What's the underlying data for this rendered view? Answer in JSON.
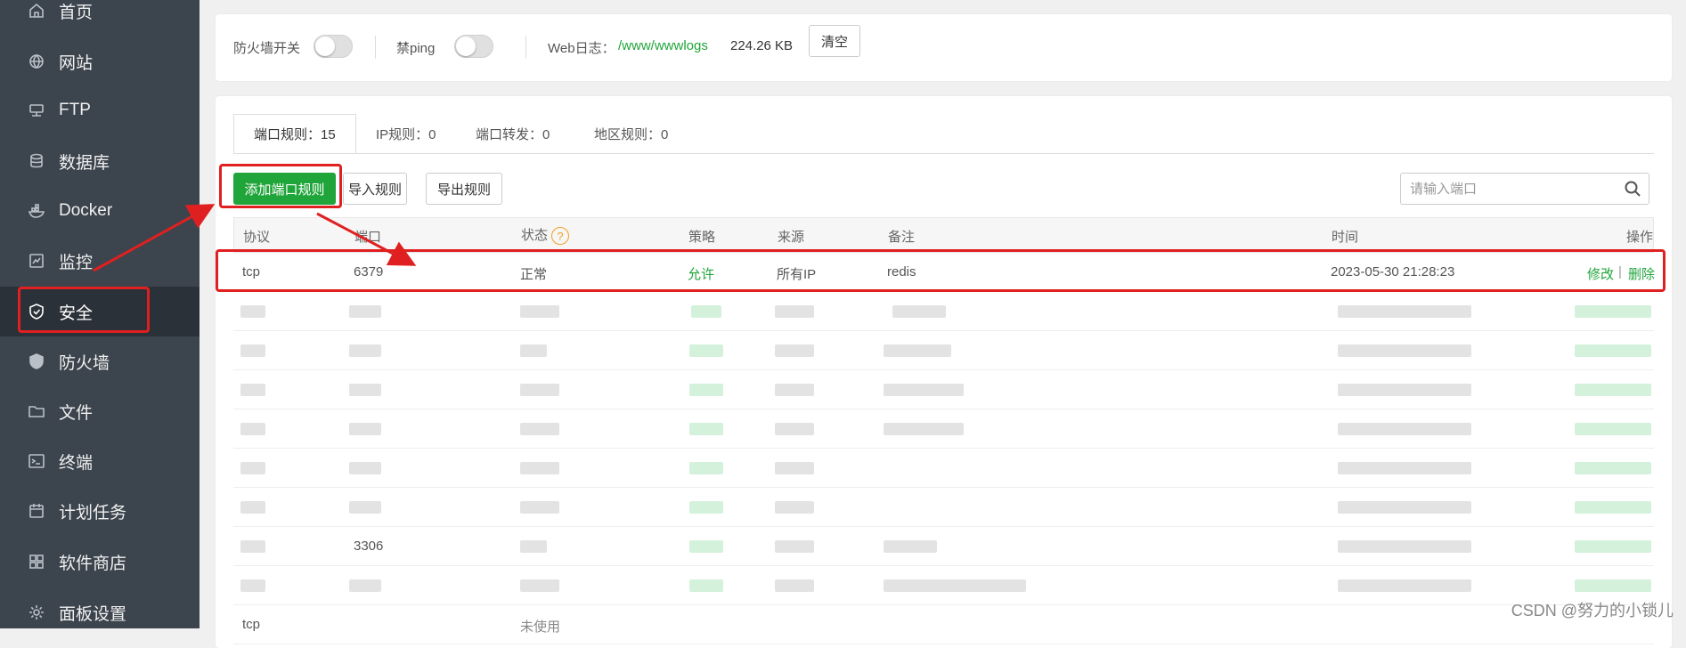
{
  "sidebar": {
    "items": [
      {
        "label": "首页",
        "icon": "home-icon"
      },
      {
        "label": "网站",
        "icon": "globe-icon"
      },
      {
        "label": "FTP",
        "icon": "ftp-icon"
      },
      {
        "label": "数据库",
        "icon": "database-icon"
      },
      {
        "label": "Docker",
        "icon": "docker-icon"
      },
      {
        "label": "监控",
        "icon": "monitor-icon"
      },
      {
        "label": "安全",
        "icon": "shield-check-icon"
      },
      {
        "label": "防火墙",
        "icon": "shield-icon"
      },
      {
        "label": "文件",
        "icon": "folder-icon"
      },
      {
        "label": "终端",
        "icon": "terminal-icon"
      },
      {
        "label": "计划任务",
        "icon": "calendar-icon"
      },
      {
        "label": "软件商店",
        "icon": "grid-icon"
      },
      {
        "label": "面板设置",
        "icon": "gear-icon"
      }
    ],
    "active": "安全"
  },
  "top_bar": {
    "firewall_label": "防火墙开关",
    "ping_label": "禁ping",
    "weblog_label": "Web日志：",
    "weblog_path": "/www/wwwlogs",
    "weblog_size": "224.26 KB",
    "clear_button": "清空"
  },
  "tabs": [
    {
      "label": "端口规则：15"
    },
    {
      "label": "IP规则：0"
    },
    {
      "label": "端口转发：0"
    },
    {
      "label": "地区规则：0"
    }
  ],
  "toolbar": {
    "add_button": "添加端口规则",
    "import_button": "导入规则",
    "export_button": "导出规则",
    "search_placeholder": "请输入端口"
  },
  "table": {
    "headers": {
      "protocol": "协议",
      "port": "端口",
      "status": "状态",
      "status_help": "?",
      "strategy": "策略",
      "source": "来源",
      "remark": "备注",
      "time": "时间",
      "actions": "操作"
    },
    "rows": [
      {
        "protocol": "tcp",
        "port": "6379",
        "status": "正常",
        "strategy": "允许",
        "source": "所有IP",
        "remark": "redis",
        "time": "2023-05-30 21:28:23",
        "edit": "修改",
        "sep": "|",
        "delete": "删除"
      },
      {
        "port": "3306",
        "protocol": "",
        "status": "",
        "strategy": "",
        "source": "",
        "remark": "",
        "time": ""
      },
      {
        "protocol": "tcp",
        "status": "未使用"
      }
    ]
  },
  "watermark": "CSDN @努力的小锁儿",
  "colors": {
    "sidebar_bg": "#3c444d",
    "sidebar_active": "#2b3138",
    "accent_green": "#20a53a",
    "annotation_red": "#e02020"
  }
}
